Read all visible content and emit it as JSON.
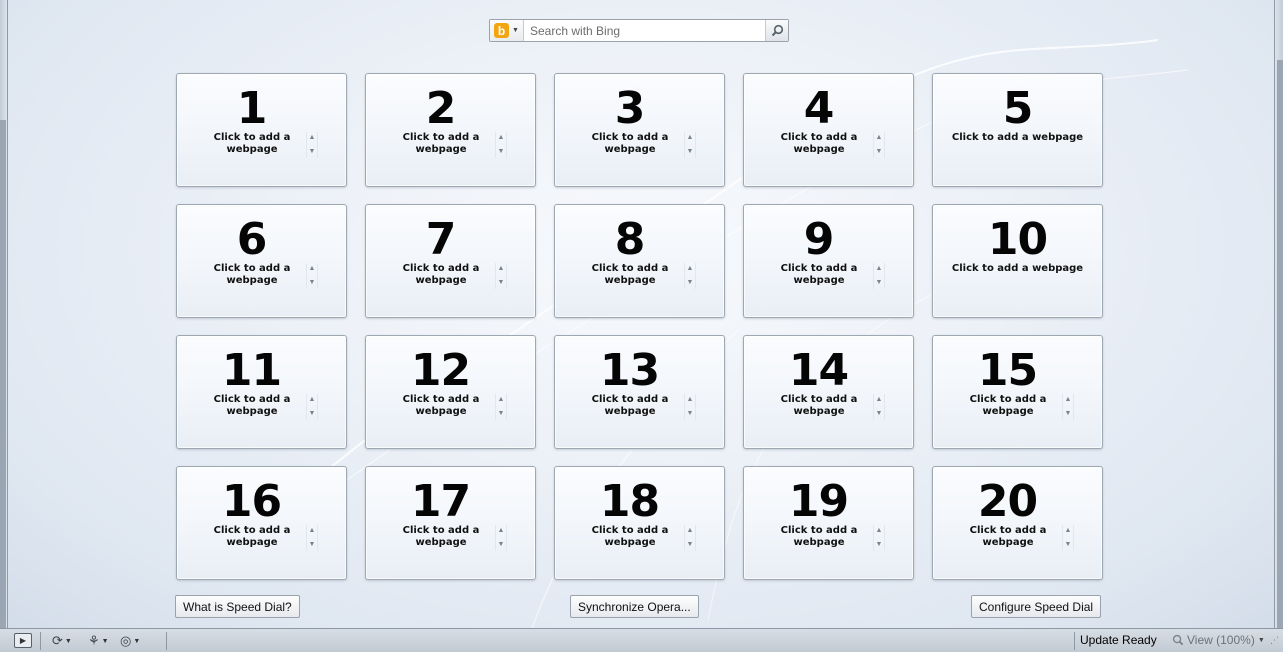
{
  "search": {
    "placeholder": "Search with Bing",
    "engine_logo": "b",
    "engine_name": "Bing",
    "engine_icon": "bing-icon",
    "dropdown_icon": "chevron-down-icon",
    "submit_icon": "magnifier-icon"
  },
  "speed_dial": {
    "tiles": [
      {
        "number": "1",
        "label": "Click to add a webpage"
      },
      {
        "number": "2",
        "label": "Click to add a webpage"
      },
      {
        "number": "3",
        "label": "Click to add a webpage"
      },
      {
        "number": "4",
        "label": "Click to add a webpage"
      },
      {
        "number": "5",
        "label": "Click to add a webpage"
      },
      {
        "number": "6",
        "label": "Click to add a webpage"
      },
      {
        "number": "7",
        "label": "Click to add a webpage"
      },
      {
        "number": "8",
        "label": "Click to add a webpage"
      },
      {
        "number": "9",
        "label": "Click to add a webpage"
      },
      {
        "number": "10",
        "label": "Click to add a webpage"
      },
      {
        "number": "11",
        "label": "Click to add a webpage"
      },
      {
        "number": "12",
        "label": "Click to add a webpage"
      },
      {
        "number": "13",
        "label": "Click to add a webpage"
      },
      {
        "number": "14",
        "label": "Click to add a webpage"
      },
      {
        "number": "15",
        "label": "Click to add a webpage"
      },
      {
        "number": "16",
        "label": "Click to add a webpage"
      },
      {
        "number": "17",
        "label": "Click to add a webpage"
      },
      {
        "number": "18",
        "label": "Click to add a webpage"
      },
      {
        "number": "19",
        "label": "Click to add a webpage"
      },
      {
        "number": "20",
        "label": "Click to add a webpage"
      }
    ]
  },
  "buttons": {
    "what_is": "What is Speed Dial?",
    "synchronize": "Synchronize Opera...",
    "configure": "Configure Speed Dial"
  },
  "statusbar": {
    "panel_toggle_icon": "panel-toggle-icon",
    "sync_icon": "sync-icon",
    "unite_icon": "unite-icon",
    "turbo_icon": "turbo-icon",
    "update_text": "Update Ready",
    "zoom_text": "View (100%)",
    "zoom_icon": "magnifier-icon"
  },
  "colors": {
    "bing_orange": "#f3a511",
    "page_background": "#eef2f8",
    "tile_border": "#9ea8b3"
  }
}
